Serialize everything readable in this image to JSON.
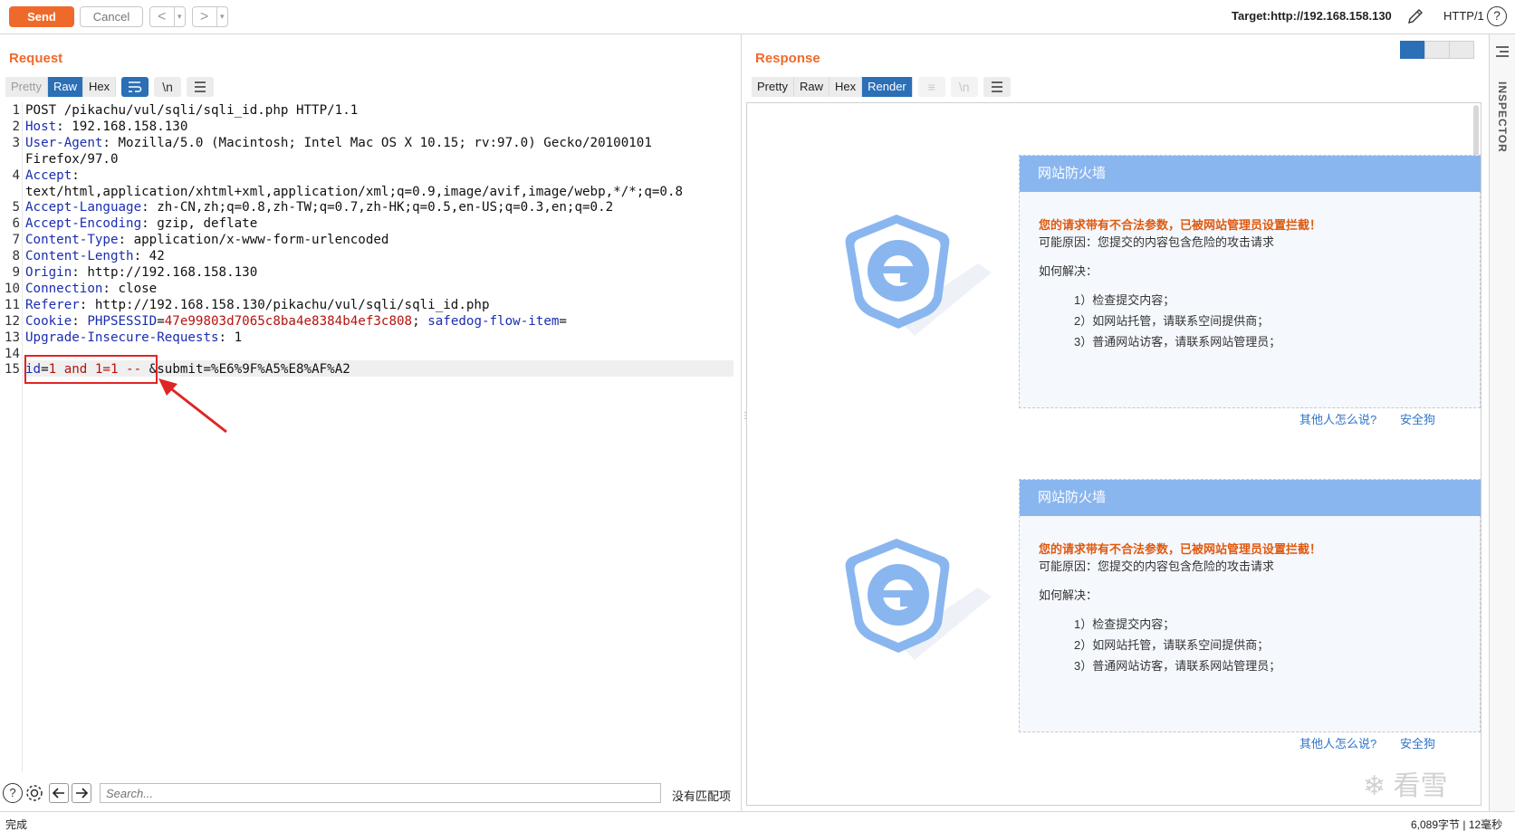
{
  "toolbar": {
    "send_label": "Send",
    "cancel_label": "Cancel",
    "back_label": "<",
    "forward_label": ">",
    "dropdown_glyph": "▾",
    "target_label": "Target:http://192.168.158.130",
    "protocol_label": "HTTP/1",
    "help_glyph": "?"
  },
  "request": {
    "title": "Request",
    "tabs": [
      "Pretty",
      "Raw",
      "Hex"
    ],
    "active_tab": "Raw",
    "icon_wrap": "wrap-lines-icon",
    "newline_label": "\\n",
    "lines": [
      {
        "n": "1",
        "text": "POST /pikachu/vul/sqli/sqli_id.php HTTP/1.1"
      },
      {
        "n": "2",
        "key": "Host",
        "val": " 192.168.158.130"
      },
      {
        "n": "3",
        "key": "User-Agent",
        "val": " Mozilla/5.0 (Macintosh; Intel Mac OS X 10.15; rv:97.0) Gecko/20100101"
      },
      {
        "n": "",
        "text": "Firefox/97.0"
      },
      {
        "n": "4",
        "key": "Accept",
        "val": ""
      },
      {
        "n": "",
        "text": "text/html,application/xhtml+xml,application/xml;q=0.9,image/avif,image/webp,*/*;q=0.8"
      },
      {
        "n": "5",
        "key": "Accept-Language",
        "val": " zh-CN,zh;q=0.8,zh-TW;q=0.7,zh-HK;q=0.5,en-US;q=0.3,en;q=0.2"
      },
      {
        "n": "6",
        "key": "Accept-Encoding",
        "val": " gzip, deflate"
      },
      {
        "n": "7",
        "key": "Content-Type",
        "val": " application/x-www-form-urlencoded"
      },
      {
        "n": "8",
        "key": "Content-Length",
        "val": " 42"
      },
      {
        "n": "9",
        "key": "Origin",
        "val": " http://192.168.158.130"
      },
      {
        "n": "10",
        "key": "Connection",
        "val": " close"
      },
      {
        "n": "11",
        "key": "Referer",
        "val": " http://192.168.158.130/pikachu/vul/sqli/sqli_id.php"
      },
      {
        "n": "12",
        "cookie": true
      },
      {
        "n": "13",
        "key": "Upgrade-Insecure-Requests",
        "val": " 1"
      },
      {
        "n": "14",
        "text": ""
      },
      {
        "n": "15",
        "body": true
      }
    ],
    "cookie": {
      "key": "Cookie",
      "p1_name": "PHPSESSID",
      "p1_value": "47e99803d7065c8ba4e8384b4ef3c808",
      "sep": "; ",
      "p2_name": "safedog-flow-item",
      "p2_value": ""
    },
    "body": {
      "p1_name": "id",
      "p1_value": "1 and 1=1 -- ",
      "sep": "&",
      "p2_name": "submit",
      "p2_value": "%E6%9F%A5%E8%AF%A2"
    }
  },
  "response": {
    "title": "Response",
    "tabs": [
      "Pretty",
      "Raw",
      "Hex",
      "Render"
    ],
    "active_tab": "Render",
    "cards": [
      {
        "header": "网站防火墙",
        "warning": "您的请求带有不合法参数，已被网站管理员设置拦截！",
        "reason": "可能原因：您提交的内容包含危险的攻击请求",
        "how": "如何解决：",
        "steps": [
          "1）检查提交内容；",
          "2）如网站托管，请联系空间提供商；",
          "3）普通网站访客，请联系网站管理员；"
        ],
        "link1": "其他人怎么说?",
        "link2": "安全狗"
      },
      {
        "header": "网站防火墙",
        "warning": "您的请求带有不合法参数，已被网站管理员设置拦截！",
        "reason": "可能原因：您提交的内容包含危险的攻击请求",
        "how": "如何解决：",
        "steps": [
          "1）检查提交内容；",
          "2）如网站托管，请联系空间提供商；",
          "3）普通网站访客，请联系网站管理员；"
        ],
        "link1": "其他人怎么说?",
        "link2": "安全狗"
      }
    ]
  },
  "inspector": {
    "label": "INSPECTOR"
  },
  "search": {
    "placeholder": "Search...",
    "no_match": "没有匹配项"
  },
  "status": {
    "left": "完成",
    "right": "6,089字节 | 12毫秒"
  },
  "watermark": "❄ 看雪",
  "colors": {
    "accent": "#ef6a2a",
    "tab_active": "#2b6fb6",
    "fw_header": "#8ab6ef",
    "warning": "#e0590e",
    "link": "#2f74c8",
    "highlight_box": "#e02525"
  }
}
